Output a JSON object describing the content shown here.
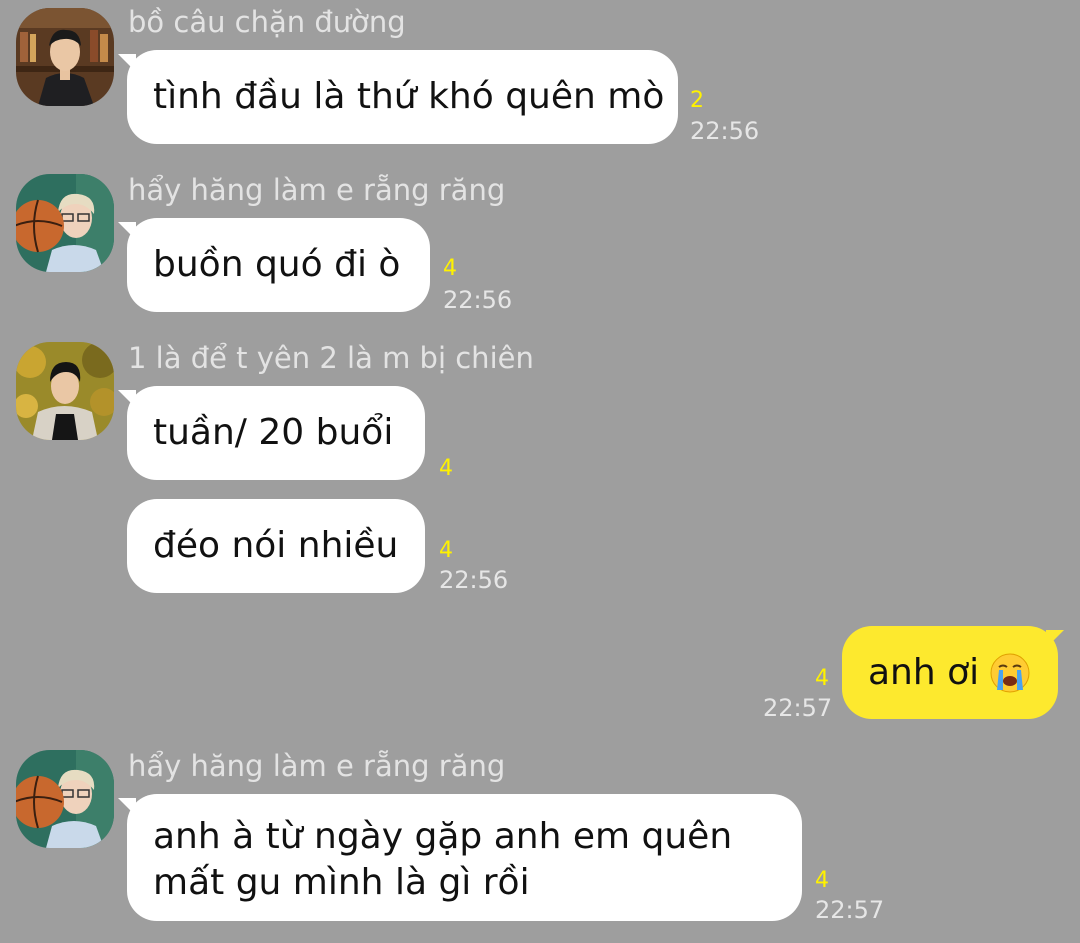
{
  "messages": [
    {
      "sender": "bồ câu chặn đường",
      "text": "tình đầu là thứ khó quên mò",
      "count": "2",
      "time": "22:56"
    },
    {
      "sender": "hẩy hăng làm e rẵng răng",
      "text": "buồn quó đi ò",
      "count": "4",
      "time": "22:56"
    },
    {
      "sender": "1 là để t yên 2 là m bị chiên",
      "text": "tuần/ 20 buổi",
      "count": "4"
    },
    {
      "text": "đéo nói nhiều",
      "count": "4",
      "time": "22:56"
    },
    {
      "text": "anh ơi",
      "count": "4",
      "time": "22:57"
    },
    {
      "sender": "hẩy hăng làm e rẵng răng",
      "text_line1": "anh à từ ngày gặp anh em quên",
      "text_line2": "mất gu mình là gì rồi",
      "count": "4",
      "time": "22:57"
    }
  ],
  "icons": {
    "avatar1": "avatar-man-bookshelf-icon",
    "avatar2": "avatar-boy-basketball-icon",
    "avatar3": "avatar-boy-autumn-icon",
    "emoji": "crying-face-emoji"
  },
  "colors": {
    "background": "#9e9e9e",
    "incoming_bubble": "#ffffff",
    "outgoing_bubble": "#fde92e",
    "unread_count": "#fff200"
  }
}
